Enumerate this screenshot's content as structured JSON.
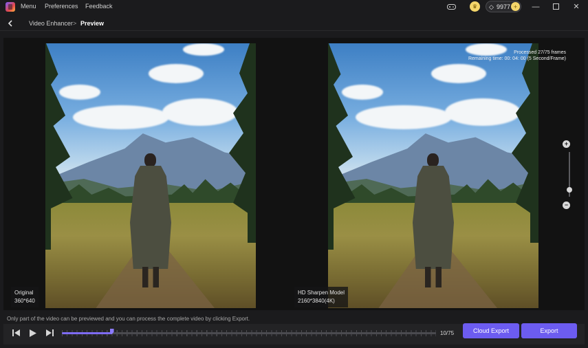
{
  "titlebar": {
    "menu": "Menu",
    "preferences": "Preferences",
    "feedback": "Feedback",
    "credits": "9977",
    "icons": [
      "app-logo",
      "gamepad-icon",
      "coin-icon",
      "diamond-icon",
      "add-credits-icon",
      "minimize-icon",
      "maximize-icon",
      "close-icon"
    ]
  },
  "breadcrumb": {
    "parent": "Video Enhancer",
    "separator": ">",
    "current": "Preview"
  },
  "preview": {
    "original": {
      "label": "Original",
      "resolution": "360*640"
    },
    "enhanced": {
      "label": "HD Sharpen Model",
      "resolution": "2160*3840(4K)"
    },
    "processed": "Processed 27/75 frames",
    "remaining": "Remaining time: 00: 04: 00 (5 Second/Frame)",
    "zoom_plus": "+",
    "zoom_minus": "−"
  },
  "hint": "Only part of the video can be previewed and you can process the complete video by clicking Export.",
  "player": {
    "frame_count": "10/75",
    "current_frame": 10,
    "total_frames": 75
  },
  "actions": {
    "cloud_export": "Cloud Export",
    "export": "Export"
  },
  "colors": {
    "accent": "#6c5cf0",
    "background": "#1b1b1d"
  }
}
